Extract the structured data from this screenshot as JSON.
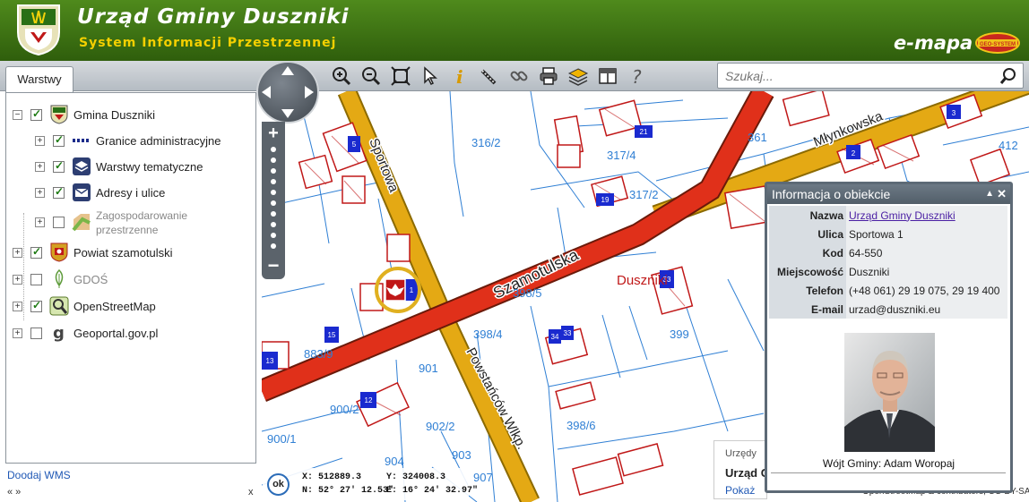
{
  "header": {
    "title": "Urząd Gminy Duszniki",
    "subtitle": "System Informacji Przestrzennej",
    "brand": "e-mapa",
    "brand_logo_text": "GEO-SYSTEM",
    "accent": "#3d7314",
    "subtitle_color": "#f5d000"
  },
  "tabs": {
    "layers": "Warstwy"
  },
  "toolbar": {
    "tools": [
      "zoom-in-icon",
      "zoom-out-icon",
      "full-extent-icon",
      "pointer-icon",
      "info-icon",
      "measure-icon",
      "link-icon",
      "print-icon",
      "layers-icon",
      "layout-icon",
      "help-icon"
    ]
  },
  "search": {
    "placeholder": "Szukaj..."
  },
  "layers": [
    {
      "label": "Gmina Duszniki",
      "checked": true,
      "icon": "commune-crest-icon"
    },
    {
      "label": "Granice administracyjne",
      "checked": true,
      "icon": "boundary-icon"
    },
    {
      "label": "Warstwy tematyczne",
      "checked": true,
      "icon": "thematic-layers-icon"
    },
    {
      "label": "Adresy i ulice",
      "checked": true,
      "icon": "address-envelope-icon"
    },
    {
      "label": "Zagospodarowanie przestrzenne",
      "checked": false,
      "icon": "zoning-icon"
    },
    {
      "label": "Powiat szamotulski",
      "checked": true,
      "icon": "county-crest-icon"
    },
    {
      "label": "GDOŚ",
      "checked": false,
      "icon": "leaf-icon"
    },
    {
      "label": "OpenStreetMap",
      "checked": true,
      "icon": "osm-icon"
    },
    {
      "label": "Geoportal.gov.pl",
      "checked": false,
      "icon": "geoportal-icon"
    }
  ],
  "panel": {
    "add_wms": "Doodaj WMS",
    "collapse": "« »",
    "close": "x"
  },
  "map": {
    "streets": [
      "Sportowa",
      "Szamotulska",
      "Młynkowska",
      "Powstańców Wlkp."
    ],
    "place": "Duszniki",
    "parcels": [
      "316/2",
      "317/4",
      "317/2",
      "361",
      "412",
      "398/5",
      "398/4",
      "399",
      "883/9",
      "901",
      "900/2",
      "902/2",
      "900/1",
      "398/6",
      "904",
      "903",
      "907"
    ],
    "buildings": [
      "5",
      "21",
      "19",
      "3",
      "2",
      "1",
      "15",
      "13",
      "12",
      "33",
      "34",
      "33"
    ]
  },
  "coords": {
    "ok": "ok",
    "x": "X: 512889.3",
    "y": "Y: 324008.3",
    "n": "N: 52° 27' 12.53\"",
    "e": "E: 16° 24' 32.97\""
  },
  "info": {
    "title": "Informacja o obiekcie",
    "rows": [
      {
        "key": "Nazwa",
        "value": "Urząd Gminy Duszniki",
        "link": true
      },
      {
        "key": "Ulica",
        "value": "Sportowa 1"
      },
      {
        "key": "Kod",
        "value": "64-550"
      },
      {
        "key": "Miejscowość",
        "value": "Duszniki"
      },
      {
        "key": "Telefon",
        "value": "(+48 061) 29 19 075, 29 19 400"
      },
      {
        "key": "E-mail",
        "value": "urzad@duszniki.eu"
      }
    ],
    "caption": "Wójt Gminy: Adam Woropaj"
  },
  "side_card": {
    "sub": "Urzędy",
    "title": "Urząd G",
    "link": "Pokaż"
  },
  "credit": "OpenStreetMap & contributors, CC-BY-SA"
}
